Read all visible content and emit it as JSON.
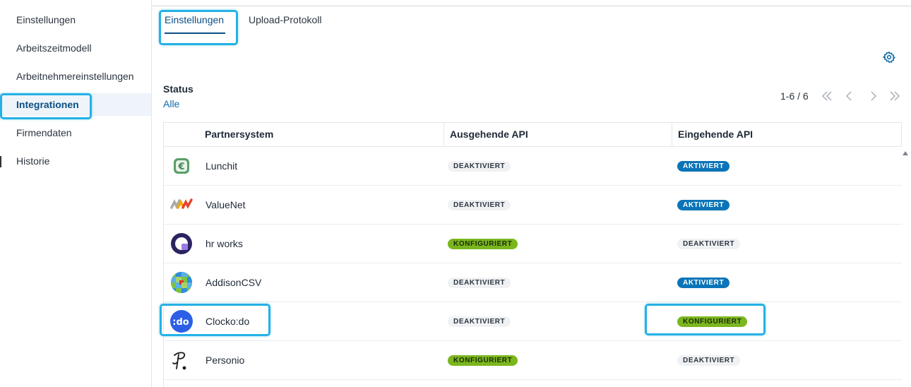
{
  "sidebar": {
    "items": [
      {
        "label": "Einstellungen"
      },
      {
        "label": "Arbeitszeitmodell"
      },
      {
        "label": "Arbeitnehmereinstellungen"
      },
      {
        "label": "Integrationen"
      },
      {
        "label": "Firmendaten"
      },
      {
        "label": "Historie"
      }
    ],
    "active_index": 3
  },
  "tabs": [
    {
      "label": "Einstellungen"
    },
    {
      "label": "Upload-Protokoll"
    }
  ],
  "icons": {
    "settings": "gear-icon"
  },
  "filter": {
    "label": "Status",
    "value": "Alle"
  },
  "pagination": {
    "range": "1-6 / 6"
  },
  "table": {
    "columns": [
      "Partnersystem",
      "Ausgehende API",
      "Eingehende API"
    ],
    "rows": [
      {
        "name": "Lunchit",
        "outgoing": "DEAKTIVIERT",
        "incoming": "AKTIVIERT",
        "logo": "lunchit-logo"
      },
      {
        "name": "ValueNet",
        "outgoing": "DEAKTIVIERT",
        "incoming": "AKTIVIERT",
        "logo": "valuenet-logo"
      },
      {
        "name": "hr works",
        "outgoing": "KONFIGURIERT",
        "incoming": "DEAKTIVIERT",
        "logo": "hrworks-logo"
      },
      {
        "name": "AddisonCSV",
        "outgoing": "DEAKTIVIERT",
        "incoming": "AKTIVIERT",
        "logo": "addison-logo"
      },
      {
        "name": "Clocko:do",
        "outgoing": "DEAKTIVIERT",
        "incoming": "KONFIGURIERT",
        "logo": "clockodo-logo"
      },
      {
        "name": "Personio",
        "outgoing": "KONFIGURIERT",
        "incoming": "DEAKTIVIERT",
        "logo": "personio-logo"
      }
    ]
  },
  "logo_text": {
    "clockodo": ":do"
  },
  "colors": {
    "accent": "#0b4f86",
    "link": "#0b6aa8",
    "active_badge": "#0b74b8",
    "configured_badge": "#7ab61e",
    "highlight": "#24b1e6"
  }
}
